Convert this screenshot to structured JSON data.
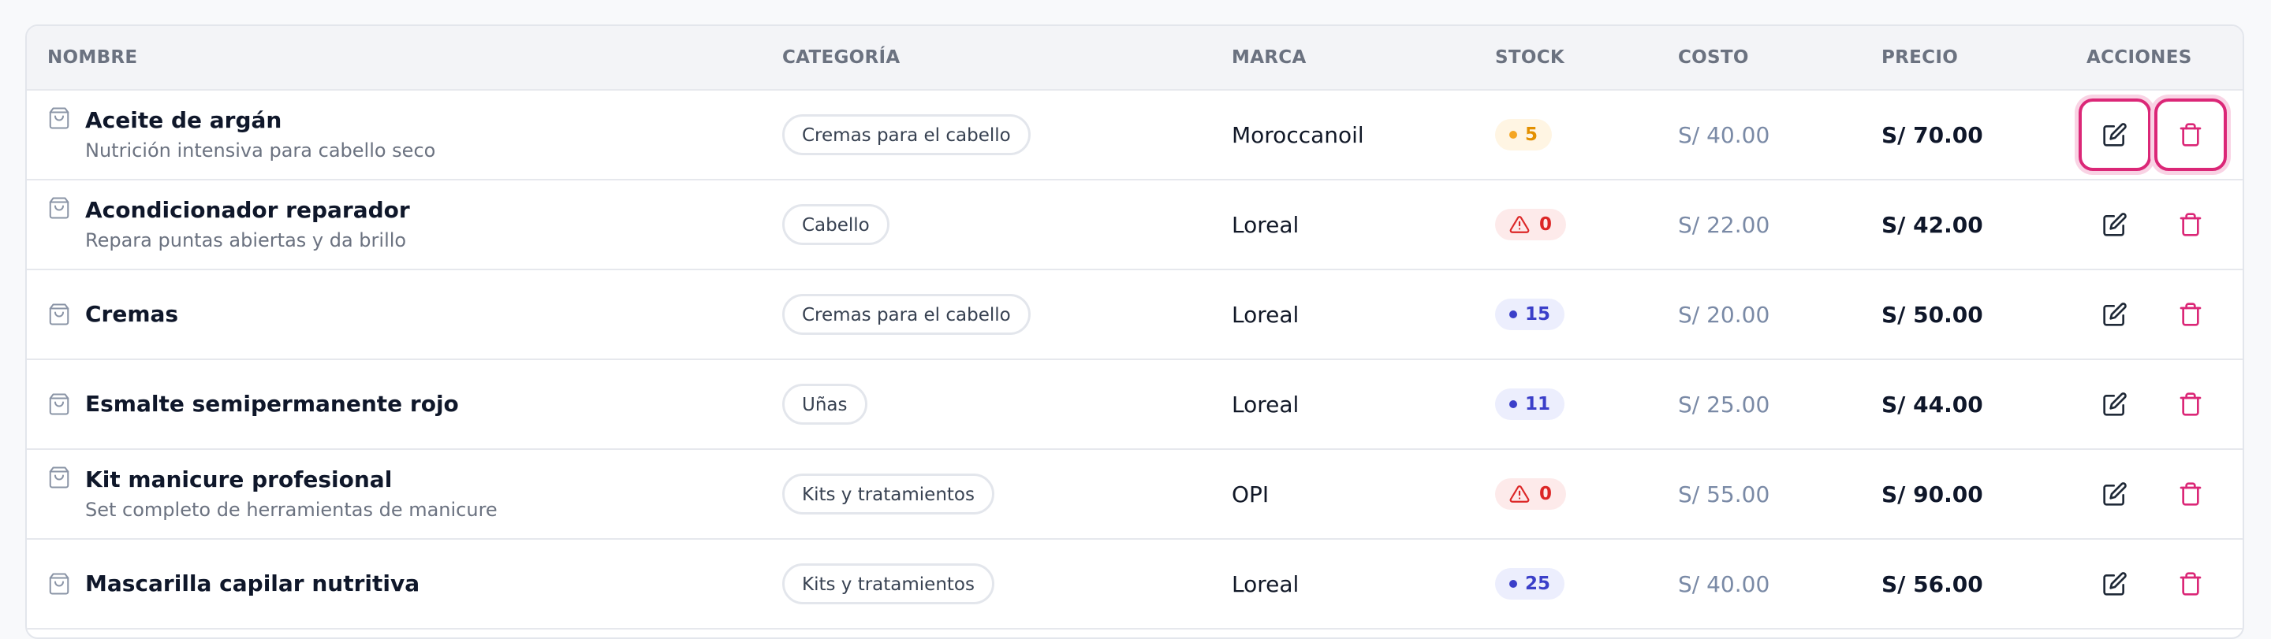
{
  "columns": {
    "nombre": "NOMBRE",
    "categoria": "CATEGORÍA",
    "marca": "MARCA",
    "stock": "STOCK",
    "costo": "COSTO",
    "precio": "PRECIO",
    "acciones": "ACCIONES"
  },
  "colors": {
    "stock_low": "#f5a623",
    "stock_out": "#dc2626",
    "stock_ok": "#3b3fc9",
    "delete": "#db2777"
  },
  "rows": [
    {
      "name": "Aceite de argán",
      "description": "Nutrición intensiva para cabello seco",
      "category": "Cremas para el cabello",
      "brand": "Moroccanoil",
      "stock": "5",
      "stock_status": "low",
      "cost": "S/ 40.00",
      "price": "S/ 70.00",
      "focused_actions": true
    },
    {
      "name": "Acondicionador reparador",
      "description": "Repara puntas abiertas y da brillo",
      "category": "Cabello",
      "brand": "Loreal",
      "stock": "0",
      "stock_status": "out",
      "cost": "S/ 22.00",
      "price": "S/ 42.00"
    },
    {
      "name": "Cremas",
      "description": "",
      "category": "Cremas para el cabello",
      "brand": "Loreal",
      "stock": "15",
      "stock_status": "ok",
      "cost": "S/ 20.00",
      "price": "S/ 50.00"
    },
    {
      "name": "Esmalte semipermanente rojo",
      "description": "",
      "category": "Uñas",
      "brand": "Loreal",
      "stock": "11",
      "stock_status": "ok",
      "cost": "S/ 25.00",
      "price": "S/ 44.00"
    },
    {
      "name": "Kit manicure profesional",
      "description": "Set completo de herramientas de manicure",
      "category": "Kits y tratamientos",
      "brand": "OPI",
      "stock": "0",
      "stock_status": "out",
      "cost": "S/ 55.00",
      "price": "S/ 90.00"
    },
    {
      "name": "Mascarilla capilar nutritiva",
      "description": "",
      "category": "Kits y tratamientos",
      "brand": "Loreal",
      "stock": "25",
      "stock_status": "ok",
      "cost": "S/ 40.00",
      "price": "S/ 56.00"
    }
  ]
}
